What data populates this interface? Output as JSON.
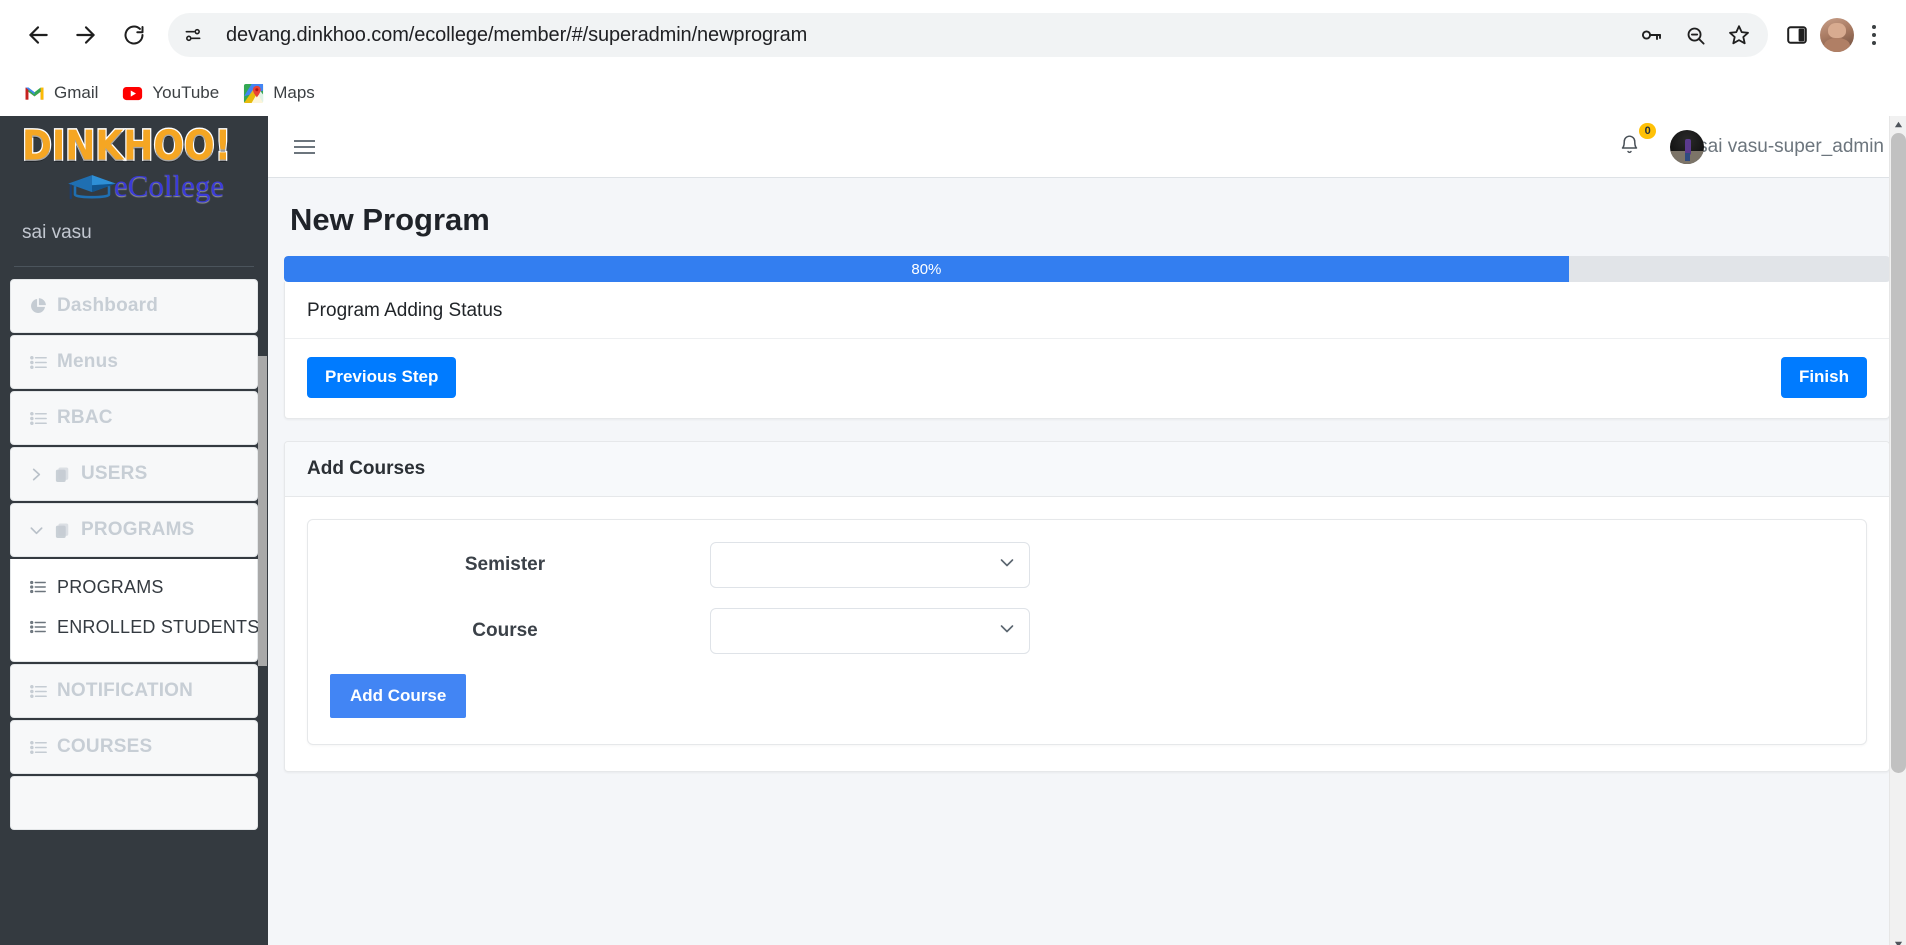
{
  "browser": {
    "back_label": "Back",
    "forward_label": "Forward",
    "reload_label": "Reload",
    "site_info_label": "View site information",
    "url": "devang.dinkhoo.com/ecollege/member/#/superadmin/newprogram",
    "passwords_label": "Passwords",
    "zoom_label": "Zoom",
    "bookmark_label": "Bookmark this tab",
    "side_panel_label": "Side panel",
    "profile_label": "Profile",
    "menu_label": "Customize and control Chrome",
    "bookmarks": [
      {
        "label": "Gmail",
        "icon": "gmail-icon"
      },
      {
        "label": "YouTube",
        "icon": "youtube-icon"
      },
      {
        "label": "Maps",
        "icon": "maps-icon"
      }
    ]
  },
  "sidebar": {
    "logo_primary": "DINKHOO!",
    "logo_secondary": "eCollege",
    "username": "sai vasu",
    "items": [
      {
        "label": "Dashboard",
        "icon": "pie-chart-icon",
        "expandable": false,
        "active": false
      },
      {
        "label": "Menus",
        "icon": "list-icon",
        "expandable": false,
        "active": false
      },
      {
        "label": "RBAC",
        "icon": "list-icon",
        "expandable": false,
        "active": false
      },
      {
        "label": "USERS",
        "icon": "copy-icon",
        "expandable": true,
        "expanded": false
      },
      {
        "label": "PROGRAMS",
        "icon": "copy-icon",
        "expandable": true,
        "expanded": true
      },
      {
        "label": "NOTIFICATION",
        "icon": "list-icon",
        "expandable": false,
        "active": false
      },
      {
        "label": "COURSES",
        "icon": "list-icon",
        "expandable": false,
        "active": false
      }
    ],
    "programs_children": [
      {
        "label": "PROGRAMS",
        "icon": "list-icon"
      },
      {
        "label": "ENROLLED STUDENTS",
        "icon": "list-icon"
      }
    ]
  },
  "topbar": {
    "menu_toggle_label": "Toggle navigation",
    "notification_count": "0",
    "user_display_name": "sai vasu-super_admin"
  },
  "page": {
    "title": "New Program",
    "progress_percent": "80%",
    "progress_value": 80,
    "status_text": "Program Adding Status",
    "previous_step_label": "Previous Step",
    "finish_label": "Finish"
  },
  "add_courses": {
    "header": "Add Courses",
    "fields": [
      {
        "label": "Semister",
        "value": "",
        "placeholder": "",
        "options": []
      },
      {
        "label": "Course",
        "value": "",
        "placeholder": "",
        "options": []
      }
    ],
    "add_button_label": "Add Course"
  },
  "colors": {
    "accent_blue": "#007bff",
    "progress_blue": "#337ef0",
    "add_course_blue": "#4285f4",
    "sidebar_dark": "#343a40",
    "badge_yellow": "#ffc107",
    "content_bg": "#f4f6f9"
  }
}
